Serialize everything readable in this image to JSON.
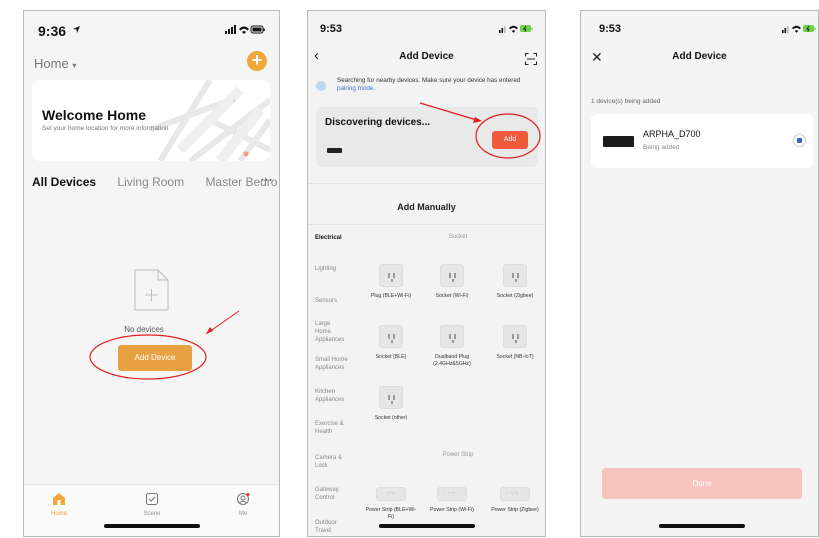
{
  "screen1": {
    "time": "9:36",
    "home_selector": "Home",
    "welcome": {
      "title": "Welcome Home",
      "subtitle": "Set your home location for more information"
    },
    "tabs": [
      "All Devices",
      "Living Room",
      "Master Bedro"
    ],
    "empty_text": "No devices",
    "add_device_label": "Add Device",
    "tabbar": [
      "Home",
      "Scene",
      "Me"
    ]
  },
  "screen2": {
    "time": "9:53",
    "title": "Add Device",
    "search_note": "Searching for nearby devices. Make sure your device has entered ",
    "search_link": "pairing mode.",
    "discovering": "Discovering devices...",
    "add_label": "Add",
    "manual_title": "Add Manually",
    "categories": [
      "Electrical",
      "Lighting",
      "Sensors",
      "Large Home Appliances",
      "Small Home Appliances",
      "Kitchen Appliances",
      "Exercise & Health",
      "Camera & Lock",
      "Gateway Control",
      "Outdoor Travel"
    ],
    "section_socket": "Socket",
    "section_strip": "Power Strip",
    "socket_items": [
      "Plug (BLE+Wi-Fi)",
      "Socket (Wi-Fi)",
      "Socket (Zigbee)",
      "Socket (BLE)",
      "Dualband Plug (2.4GHz&5GHz)",
      "Socket (NB-IoT)",
      "Socket (other)"
    ],
    "strip_items": [
      "Power Strip (BLE+Wi-Fi)",
      "Power Strip (Wi-Fi)",
      "Power Strip (Zigbee)"
    ]
  },
  "screen3": {
    "time": "9:53",
    "title": "Add Device",
    "count_text": "1 device(s) being added",
    "device_name": "ARPHA_D700",
    "device_status": "Being added",
    "done_label": "Done"
  },
  "colors": {
    "accent_orange": "#e8a142",
    "add_red": "#f05a3c",
    "annotation_red": "#e11d1d"
  },
  "icons": [
    "location-arrow-icon",
    "signal-icon",
    "wifi-icon",
    "battery-icon",
    "plus-icon",
    "doc-plus-icon",
    "home-icon",
    "scene-icon",
    "me-icon",
    "back-icon",
    "scan-icon",
    "close-icon",
    "socket-icon",
    "power-strip-icon",
    "spinner-icon"
  ]
}
